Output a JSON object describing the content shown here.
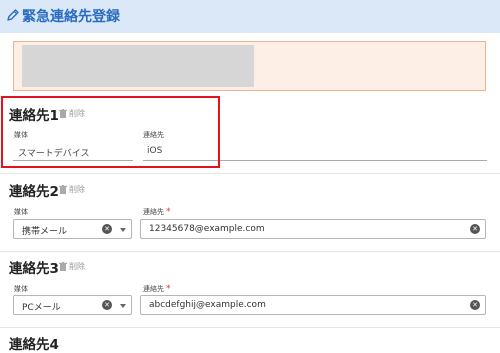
{
  "header": {
    "title": "緊急連絡先登録",
    "icon": "pencil-icon",
    "accent": "#2a6cc0",
    "background": "#dbe8f7"
  },
  "notice": {
    "background": "#fdefe6",
    "border": "#f0b38f"
  },
  "contacts": [
    {
      "title": "連絡先1",
      "delete_label": "削除",
      "media_label": "媒体",
      "media_value": "スマートデバイス",
      "dest_label": "連絡先",
      "dest_value": "iOS",
      "required": false
    },
    {
      "title": "連絡先2",
      "delete_label": "削除",
      "media_label": "媒体",
      "media_value": "携帯メール",
      "dest_label": "連絡先",
      "dest_value": "12345678@example.com",
      "required": true
    },
    {
      "title": "連絡先3",
      "delete_label": "削除",
      "media_label": "媒体",
      "media_value": "PCメール",
      "dest_label": "連絡先",
      "dest_value": "abcdefghij@example.com",
      "required": true
    },
    {
      "title": "連絡先4"
    }
  ],
  "required_mark": "*",
  "highlight_color": "#e0141e"
}
